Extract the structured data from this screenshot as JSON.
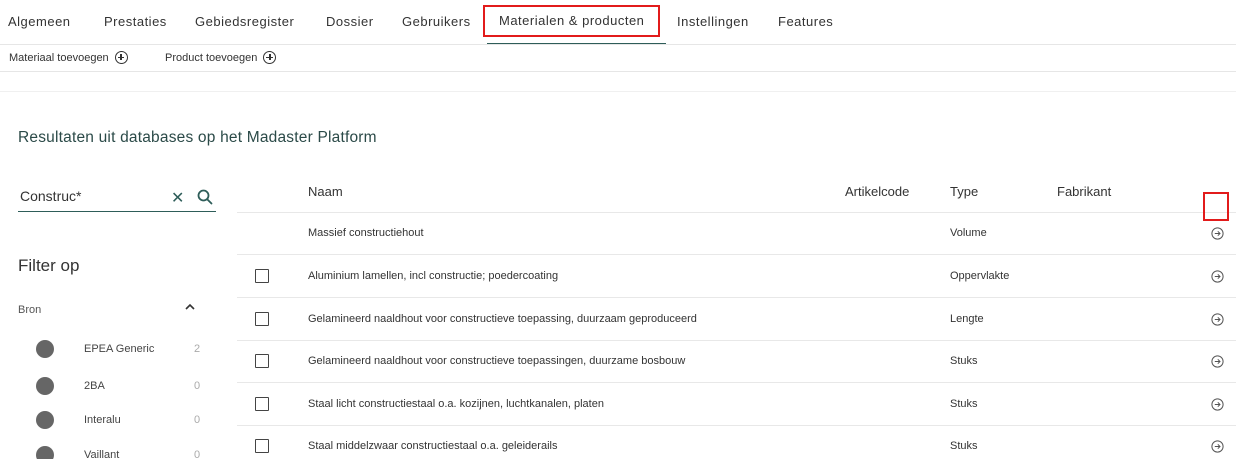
{
  "nav": {
    "tabs": [
      {
        "label": "Algemeen"
      },
      {
        "label": "Prestaties"
      },
      {
        "label": "Gebiedsregister"
      },
      {
        "label": "Dossier"
      },
      {
        "label": "Gebruikers"
      },
      {
        "label": "Materialen & producten",
        "active": true
      },
      {
        "label": "Instellingen"
      },
      {
        "label": "Features"
      }
    ]
  },
  "toolbar": {
    "add_material": "Materiaal toevoegen",
    "add_product": "Product toevoegen"
  },
  "heading": "Resultaten uit databases op het Madaster Platform",
  "search": {
    "value": "Construc*"
  },
  "filter": {
    "title": "Filter op",
    "group_label": "Bron",
    "sources": [
      {
        "name": "EPEA Generic",
        "count": "2"
      },
      {
        "name": "2BA",
        "count": "0"
      },
      {
        "name": "Interalu",
        "count": "0"
      },
      {
        "name": "Vaillant",
        "count": "0"
      }
    ]
  },
  "table": {
    "columns": {
      "naam": "Naam",
      "artikelcode": "Artikelcode",
      "type": "Type",
      "fabrikant": "Fabrikant"
    },
    "rows": [
      {
        "name": "Massief constructiehout",
        "type": "Volume",
        "checkbox": false
      },
      {
        "name": "Aluminium lamellen, incl constructie; poedercoating",
        "type": "Oppervlakte",
        "checkbox": true
      },
      {
        "name": "Gelamineerd naaldhout voor constructieve toepassing, duurzaam geproduceerd",
        "type": "Lengte",
        "checkbox": true
      },
      {
        "name": "Gelamineerd naaldhout voor constructieve toepassingen, duurzame bosbouw",
        "type": "Stuks",
        "checkbox": true
      },
      {
        "name": "Staal licht constructiestaal o.a. kozijnen, luchtkanalen, platen",
        "type": "Stuks",
        "checkbox": true
      },
      {
        "name": "Staal middelzwaar constructiestaal o.a. geleiderails",
        "type": "Stuks",
        "checkbox": true
      }
    ]
  },
  "colors": {
    "accent": "#2e5d59",
    "highlight": "#e21b1b"
  }
}
